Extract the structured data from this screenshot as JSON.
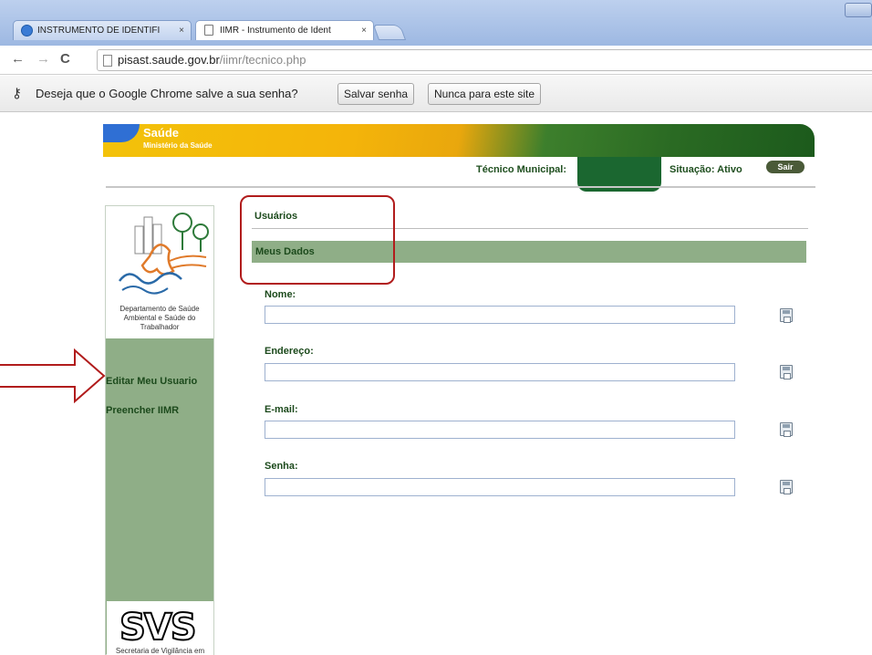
{
  "browser": {
    "tabs": [
      {
        "title": "INSTRUMENTO DE IDENTIFI",
        "close": "×"
      },
      {
        "title": "IIMR - Instrumento de Ident",
        "close": "×"
      }
    ],
    "url_domain": "pisast.saude.gov.br",
    "url_path": "/iimr/tecnico.php",
    "nav": {
      "back": "←",
      "forward": "→",
      "reload": "C"
    }
  },
  "infobar": {
    "message": "Deseja que o Google Chrome salve a sua senha?",
    "save_label": "Salvar senha",
    "never_label": "Nunca para este site"
  },
  "banner": {
    "title": "Saúde",
    "subtitle": "Ministério da Saúde"
  },
  "userbar": {
    "tecnico_label": "Técnico Municipal:",
    "situacao_label": "Situação: Ativo",
    "logout_label": "Sair"
  },
  "sidebar": {
    "dept": "Departamento de Saúde Ambiental e Saúde do Trabalhador",
    "items": [
      {
        "label": "Editar Meu Usuario"
      },
      {
        "label": "Preencher IIMR"
      }
    ],
    "svs_logo": "SVS",
    "svs_caption": "Secretaria de Vigilância em"
  },
  "main": {
    "section_title": "Usuários",
    "subsection_title": "Meus Dados",
    "fields": [
      {
        "label": "Nome:",
        "value": ""
      },
      {
        "label": "Endereço:",
        "value": ""
      },
      {
        "label": "E-mail:",
        "value": ""
      },
      {
        "label": "Senha:",
        "value": ""
      }
    ]
  },
  "colors": {
    "accent_green": "#8fae87",
    "annotation_red": "#b11c1c",
    "dark_green": "#1b6730"
  }
}
